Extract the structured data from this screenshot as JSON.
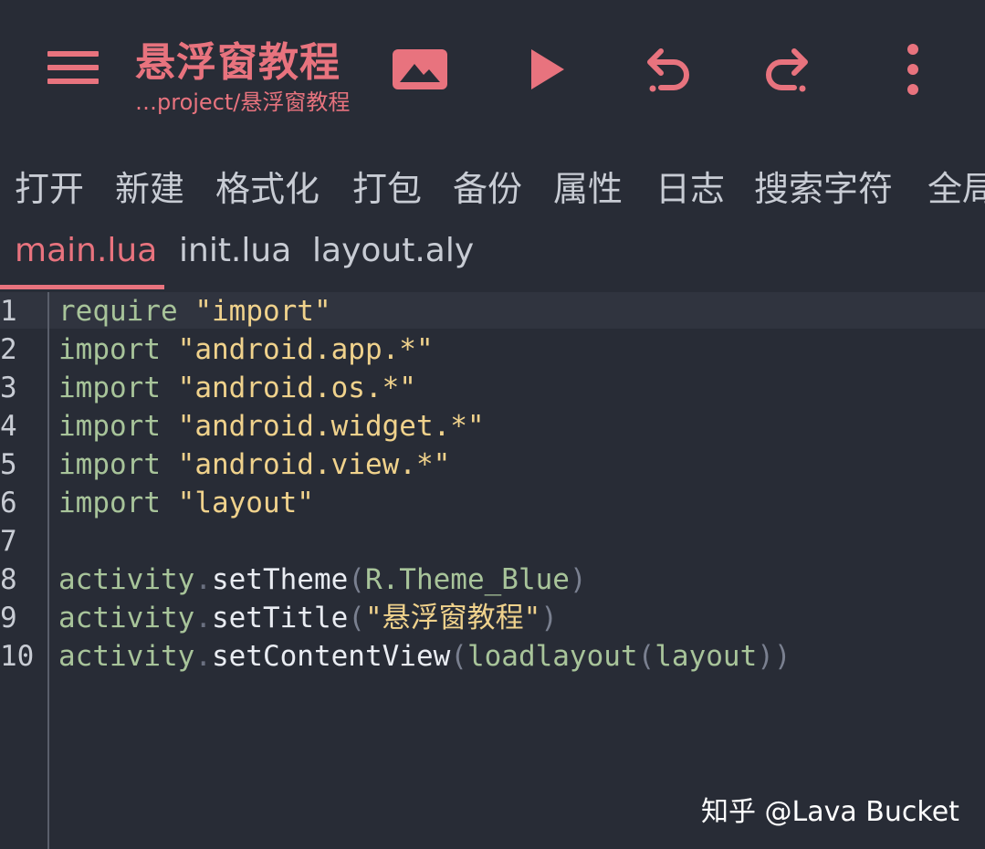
{
  "appbar": {
    "title": "悬浮窗教程",
    "subtitle": "…project/悬浮窗教程",
    "icons": [
      "menu-icon",
      "image-icon",
      "play-icon",
      "undo-icon",
      "redo-icon",
      "more-vert-icon"
    ],
    "accent_color": "#e8737e"
  },
  "menu": {
    "items": [
      "打开",
      "新建",
      "格式化",
      "打包",
      "备份",
      "属性",
      "日志",
      "搜索字符",
      "全局"
    ]
  },
  "tabs": [
    {
      "label": "main.lua",
      "active": true
    },
    {
      "label": "init.lua",
      "active": false
    },
    {
      "label": "layout.aly",
      "active": false
    }
  ],
  "editor": {
    "lines": [
      {
        "num": "1",
        "parts": [
          [
            "kw",
            "require"
          ],
          [
            "plain",
            " "
          ],
          [
            "str",
            "\"import\""
          ]
        ]
      },
      {
        "num": "2",
        "parts": [
          [
            "kw",
            "import"
          ],
          [
            "plain",
            " "
          ],
          [
            "str",
            "\"android.app.*\""
          ]
        ]
      },
      {
        "num": "3",
        "parts": [
          [
            "kw",
            "import"
          ],
          [
            "plain",
            " "
          ],
          [
            "str",
            "\"android.os.*\""
          ]
        ]
      },
      {
        "num": "4",
        "parts": [
          [
            "kw",
            "import"
          ],
          [
            "plain",
            " "
          ],
          [
            "str",
            "\"android.widget.*\""
          ]
        ]
      },
      {
        "num": "5",
        "parts": [
          [
            "kw",
            "import"
          ],
          [
            "plain",
            " "
          ],
          [
            "str",
            "\"android.view.*\""
          ]
        ]
      },
      {
        "num": "6",
        "parts": [
          [
            "kw",
            "import"
          ],
          [
            "plain",
            " "
          ],
          [
            "str",
            "\"layout\""
          ]
        ]
      },
      {
        "num": "7",
        "parts": []
      },
      {
        "num": "8",
        "parts": [
          [
            "kw",
            "activity"
          ],
          [
            "dot",
            "."
          ],
          [
            "fn",
            "setTheme"
          ],
          [
            "paren",
            "("
          ],
          [
            "arg",
            "R.Theme_Blue"
          ],
          [
            "paren",
            ")"
          ]
        ]
      },
      {
        "num": "9",
        "parts": [
          [
            "kw",
            "activity"
          ],
          [
            "dot",
            "."
          ],
          [
            "fn",
            "setTitle"
          ],
          [
            "paren",
            "("
          ],
          [
            "str",
            "\"悬浮窗教程\""
          ],
          [
            "paren",
            ")"
          ]
        ]
      },
      {
        "num": "10",
        "parts": [
          [
            "kw",
            "activity"
          ],
          [
            "dot",
            "."
          ],
          [
            "fn",
            "setContentView"
          ],
          [
            "paren",
            "("
          ],
          [
            "arg",
            "loadlayout"
          ],
          [
            "paren",
            "("
          ],
          [
            "arg",
            "layout"
          ],
          [
            "paren",
            "))"
          ]
        ]
      }
    ]
  },
  "watermark": "知乎 @Lava Bucket"
}
